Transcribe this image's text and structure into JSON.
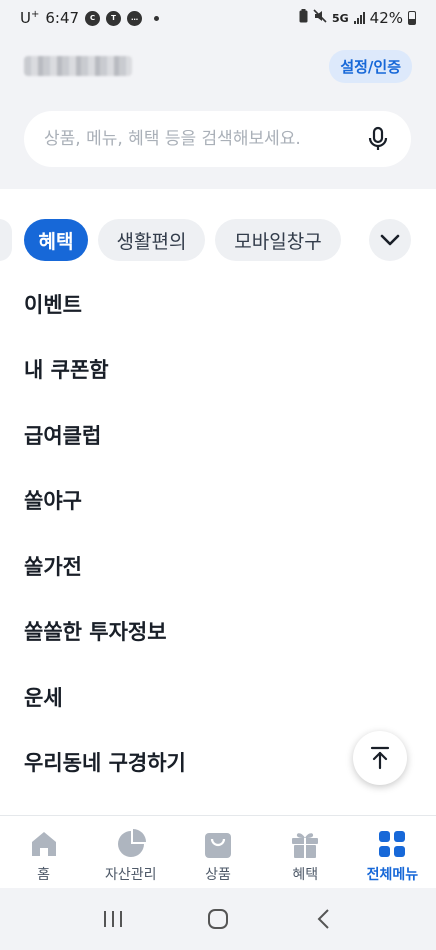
{
  "status_bar": {
    "carrier": "U",
    "carrier_sup": "+",
    "time": "6:47",
    "notification_icons": [
      "c-icon",
      "talk-icon",
      "message-icon"
    ],
    "network": "5G",
    "battery": "42%"
  },
  "header": {
    "settings_label": "설정/인증"
  },
  "search": {
    "placeholder": "상품, 메뉴, 혜택 등을 검색해보세요."
  },
  "tabs": {
    "items": [
      {
        "label": "혜택",
        "active": true
      },
      {
        "label": "생활편의",
        "active": false
      },
      {
        "label": "모바일창구",
        "active": false
      }
    ]
  },
  "menu": {
    "items": [
      {
        "label": "이벤트"
      },
      {
        "label": "내 쿠폰함"
      },
      {
        "label": "급여클럽"
      },
      {
        "label": "쏠야구"
      },
      {
        "label": "쏠가전"
      },
      {
        "label": "쏠쏠한 투자정보"
      },
      {
        "label": "운세"
      },
      {
        "label": "우리동네 구경하기"
      }
    ]
  },
  "bottom_nav": {
    "items": [
      {
        "label": "홈",
        "icon": "home-icon"
      },
      {
        "label": "자산관리",
        "icon": "pie-chart-icon"
      },
      {
        "label": "상품",
        "icon": "shopping-bag-icon"
      },
      {
        "label": "혜택",
        "icon": "gift-icon"
      },
      {
        "label": "전체메뉴",
        "icon": "grid-icon",
        "active": true
      }
    ]
  },
  "colors": {
    "accent": "#1768d8",
    "background": "#f2f3f6"
  }
}
